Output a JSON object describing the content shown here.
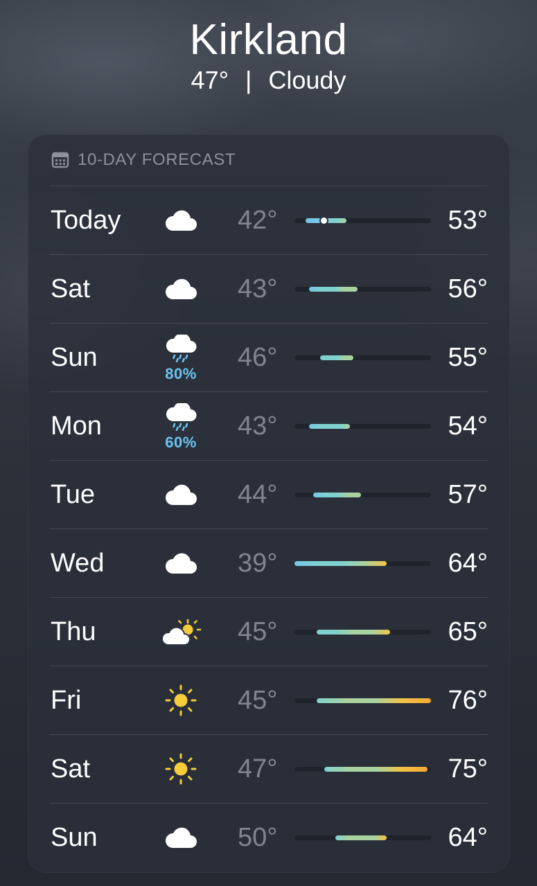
{
  "header": {
    "city": "Kirkland",
    "temperature": "47°",
    "separator": "|",
    "condition": "Cloudy"
  },
  "forecast": {
    "title": "10-DAY FORECAST",
    "icon": "calendar-icon",
    "range": {
      "min": 39,
      "max": 76
    },
    "current_temp": 47,
    "colors": {
      "cold": "#74c6ea",
      "cool": "#7fd1cf",
      "mild": "#a8d3a0",
      "warm": "#f3c246",
      "hot": "#f6a935",
      "precip": "#6cc4f0"
    },
    "days": [
      {
        "day": "Today",
        "icon": "cloud-icon",
        "precip": "",
        "low": "42°",
        "high": "53°",
        "low_value": 42,
        "high_value": 53,
        "current": true
      },
      {
        "day": "Sat",
        "icon": "cloud-icon",
        "precip": "",
        "low": "43°",
        "high": "56°",
        "low_value": 43,
        "high_value": 56,
        "current": false
      },
      {
        "day": "Sun",
        "icon": "cloud-rain-icon",
        "precip": "80%",
        "low": "46°",
        "high": "55°",
        "low_value": 46,
        "high_value": 55,
        "current": false
      },
      {
        "day": "Mon",
        "icon": "cloud-rain-icon",
        "precip": "60%",
        "low": "43°",
        "high": "54°",
        "low_value": 43,
        "high_value": 54,
        "current": false
      },
      {
        "day": "Tue",
        "icon": "cloud-icon",
        "precip": "",
        "low": "44°",
        "high": "57°",
        "low_value": 44,
        "high_value": 57,
        "current": false
      },
      {
        "day": "Wed",
        "icon": "cloud-icon",
        "precip": "",
        "low": "39°",
        "high": "64°",
        "low_value": 39,
        "high_value": 64,
        "current": false
      },
      {
        "day": "Thu",
        "icon": "partly-sunny-icon",
        "precip": "",
        "low": "45°",
        "high": "65°",
        "low_value": 45,
        "high_value": 65,
        "current": false
      },
      {
        "day": "Fri",
        "icon": "sun-icon",
        "precip": "",
        "low": "45°",
        "high": "76°",
        "low_value": 45,
        "high_value": 76,
        "current": false
      },
      {
        "day": "Sat",
        "icon": "sun-icon",
        "precip": "",
        "low": "47°",
        "high": "75°",
        "low_value": 47,
        "high_value": 75,
        "current": false
      },
      {
        "day": "Sun",
        "icon": "cloud-icon",
        "precip": "",
        "low": "50°",
        "high": "64°",
        "low_value": 50,
        "high_value": 64,
        "current": false
      }
    ]
  }
}
